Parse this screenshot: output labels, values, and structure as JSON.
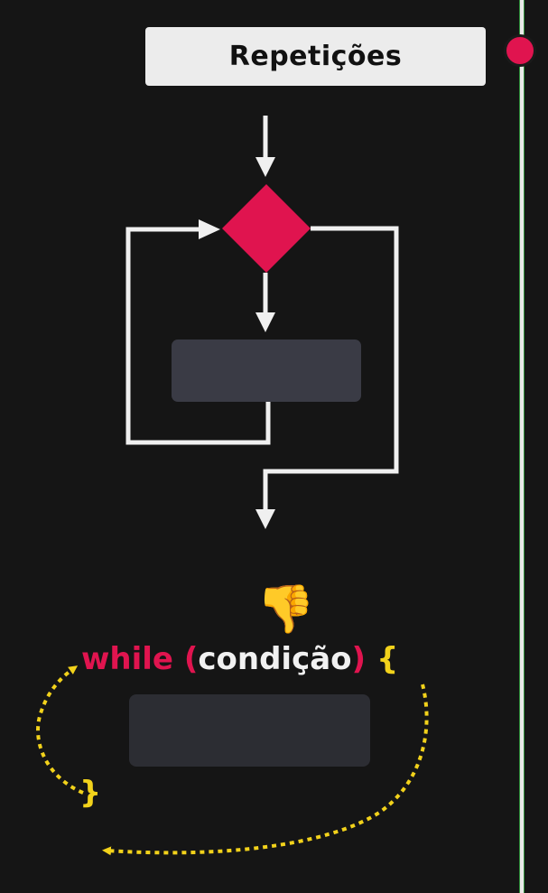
{
  "header": {
    "title": "Repetições"
  },
  "code": {
    "keyword": "while",
    "open_paren": "(",
    "condition": "condição",
    "close_paren": ")",
    "open_brace": "{",
    "close_brace": "}"
  },
  "icons": {
    "reaction": "👎",
    "reaction_name": "thumbs-down-icon"
  },
  "colors": {
    "background": "#151515",
    "accent": "#e0144f",
    "flow": "#f0f0f0",
    "block": "#3a3b45",
    "loop_arrow": "#f2d21b"
  }
}
